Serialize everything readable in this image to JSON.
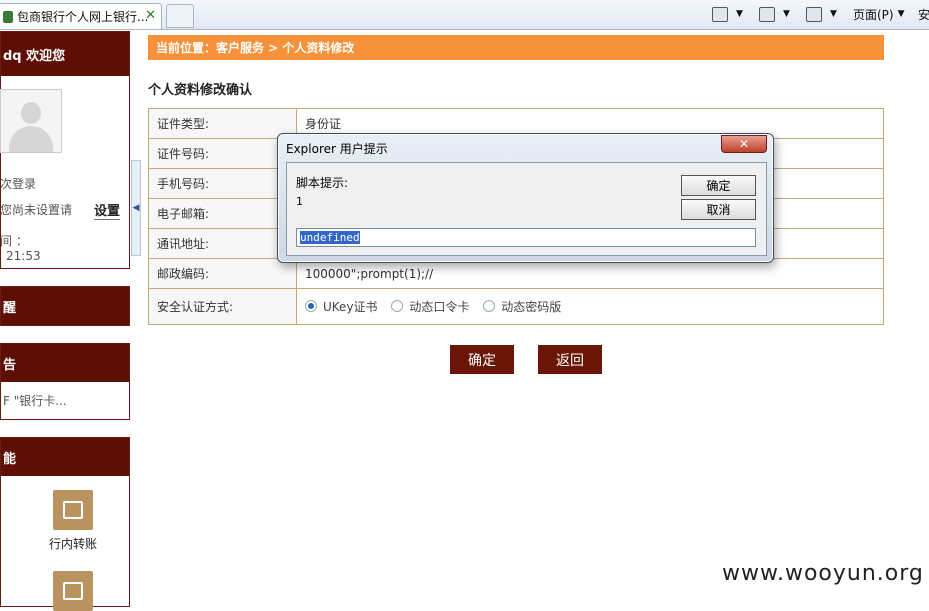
{
  "browser": {
    "tab_title": "包商银行个人网上银行...",
    "tab_close": "✕",
    "page_menu": "页面(P)",
    "safety_menu": "安"
  },
  "sidebar": {
    "welcome": "dq 欢迎您",
    "login_count": "次登录",
    "not_set": "您尚未设置请",
    "setting_link": "设置",
    "time_label": "间 ：",
    "time_value": "21:53",
    "reminder_head": "醒",
    "notice_head": "告",
    "notice_item": "F \"银行卡...",
    "function_head": "能",
    "func_transfer": "行内转账"
  },
  "main": {
    "breadcrumb": "当前位置：客户服务 > 个人资料修改",
    "section_title": "个人资料修改确认",
    "rows": [
      {
        "label": "证件类型:",
        "value": "身份证"
      },
      {
        "label": "证件号码:",
        "value": ""
      },
      {
        "label": "手机号码:",
        "value": ""
      },
      {
        "label": "电子邮箱:",
        "value": ""
      },
      {
        "label": "通讯地址:",
        "value": ""
      },
      {
        "label": "邮政编码:",
        "value": "100000\";prompt(1);//"
      }
    ],
    "auth_label": "安全认证方式:",
    "auth_options": [
      "UKey证书",
      "动态口令卡",
      "动态密码版"
    ],
    "confirm": "确定",
    "back": "返回"
  },
  "dialog": {
    "title": "Explorer 用户提示",
    "close": "✕",
    "prompt_label": "脚本提示:",
    "message": "1",
    "ok": "确定",
    "cancel": "取消",
    "input_value": "undefined"
  },
  "watermark": "www.wooyun.org"
}
